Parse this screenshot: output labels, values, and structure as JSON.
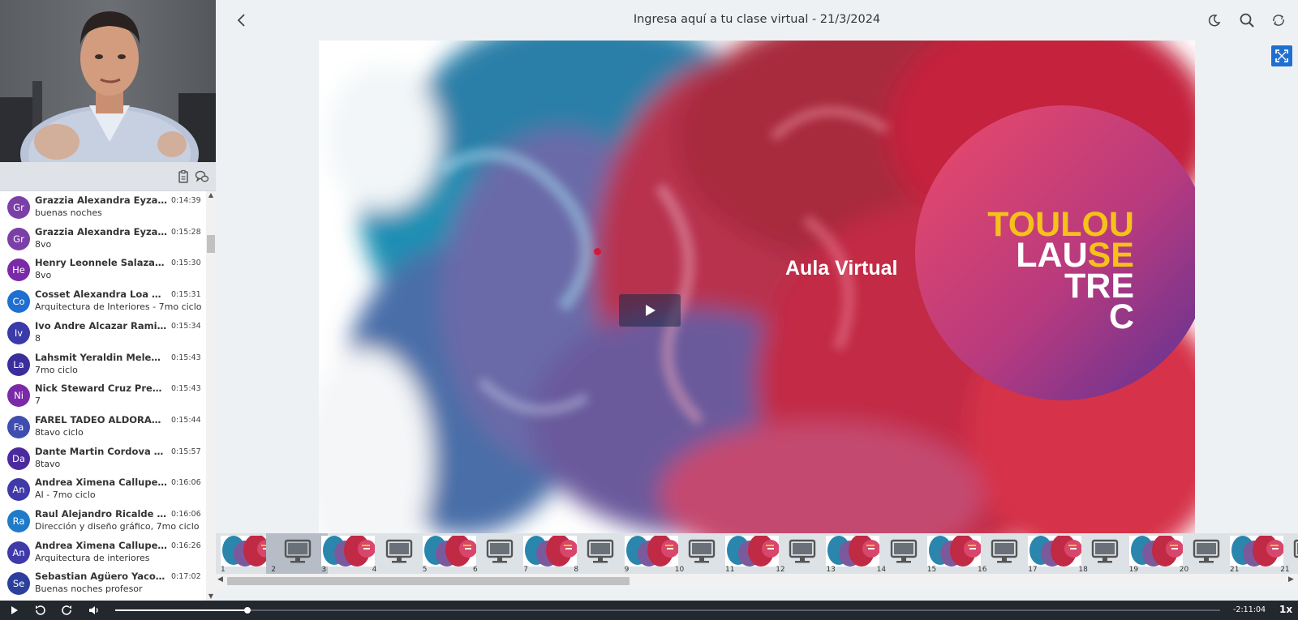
{
  "header": {
    "title": "Ingresa aquí a tu clase virtual - 21/3/2024"
  },
  "slide": {
    "heading": "Aula Virtual",
    "logo_lines": [
      {
        "parts": [
          {
            "text": "TOULOU",
            "color": "#f5c11a"
          }
        ]
      },
      {
        "parts": [
          {
            "text": "LAU",
            "color": "#ffffff"
          },
          {
            "text": "SE",
            "color": "#f5c11a"
          }
        ]
      },
      {
        "parts": [
          {
            "text": "TRE",
            "color": "#ffffff"
          }
        ]
      },
      {
        "parts": [
          {
            "text": "C",
            "color": "#ffffff"
          }
        ]
      }
    ]
  },
  "chat": {
    "messages": [
      {
        "initials": "Gr",
        "name": "Grazzia Alexandra Eyzag...",
        "time": "0:14:39",
        "text": "buenas noches",
        "color": "#7b3fa8"
      },
      {
        "initials": "Gr",
        "name": "Grazzia Alexandra Eyzag...",
        "time": "0:15:28",
        "text": "8vo",
        "color": "#7b3fa8"
      },
      {
        "initials": "He",
        "name": "Henry Leonnele Salazar ...",
        "time": "0:15:30",
        "text": "8vo",
        "color": "#7a2aa8"
      },
      {
        "initials": "Co",
        "name": "Cosset Alexandra Loa Cruz",
        "time": "0:15:31",
        "text": "Arquitectura de Interiores - 7mo ciclo",
        "color": "#1f6fd1"
      },
      {
        "initials": "Iv",
        "name": "Ivo Andre Alcazar Ramirez",
        "time": "0:15:34",
        "text": "8",
        "color": "#3a3aa8"
      },
      {
        "initials": "La",
        "name": "Lahsmit Yeraldin Melend...",
        "time": "0:15:43",
        "text": "7mo ciclo",
        "color": "#3a2d9c"
      },
      {
        "initials": "Ni",
        "name": "Nick Steward Cruz Precia...",
        "time": "0:15:43",
        "text": "7",
        "color": "#7a2aa8"
      },
      {
        "initials": "Fa",
        "name": "FAREL TADEO ALDORADI...",
        "time": "0:15:44",
        "text": "8tavo ciclo",
        "color": "#3f4cb0"
      },
      {
        "initials": "Da",
        "name": "Dante Martin Cordova M...",
        "time": "0:15:57",
        "text": "8tavo",
        "color": "#4a2a9c"
      },
      {
        "initials": "An",
        "name": "Andrea Ximena Callupe Y...",
        "time": "0:16:06",
        "text": "AI - 7mo ciclo",
        "color": "#3f3aa8"
      },
      {
        "initials": "Ra",
        "name": "Raul Alejandro Ricalde C...",
        "time": "0:16:06",
        "text": "Dirección y diseño gráfico, 7mo ciclo",
        "color": "#1f7ac8"
      },
      {
        "initials": "An",
        "name": "Andrea Ximena Callupe Y...",
        "time": "0:16:26",
        "text": "Arquitectura de interiores",
        "color": "#3f3aa8"
      },
      {
        "initials": "Se",
        "name": "Sebastian Agüero Yacolca",
        "time": "0:17:02",
        "text": "Buenas noches profesor",
        "color": "#2d3f9c"
      }
    ]
  },
  "thumbnails": [
    {
      "num": "1",
      "kind": "slide"
    },
    {
      "num": "2",
      "kind": "screen",
      "active": true
    },
    {
      "num": "3",
      "kind": "slide"
    },
    {
      "num": "4",
      "kind": "screen"
    },
    {
      "num": "5",
      "kind": "slide"
    },
    {
      "num": "6",
      "kind": "screen"
    },
    {
      "num": "7",
      "kind": "slide"
    },
    {
      "num": "8",
      "kind": "screen"
    },
    {
      "num": "9",
      "kind": "slide"
    },
    {
      "num": "10",
      "kind": "screen"
    },
    {
      "num": "11",
      "kind": "slide"
    },
    {
      "num": "12",
      "kind": "screen"
    },
    {
      "num": "13",
      "kind": "slide"
    },
    {
      "num": "14",
      "kind": "screen"
    },
    {
      "num": "15",
      "kind": "slide"
    },
    {
      "num": "16",
      "kind": "screen"
    },
    {
      "num": "17",
      "kind": "slide"
    },
    {
      "num": "18",
      "kind": "screen"
    },
    {
      "num": "19",
      "kind": "slide"
    },
    {
      "num": "20",
      "kind": "screen"
    },
    {
      "num": "21",
      "kind": "slide"
    },
    {
      "num": "21",
      "kind": "screen"
    }
  ],
  "player": {
    "progress_fraction": 0.12,
    "time_remaining": "-2:11:04",
    "speed": "1x"
  },
  "colors": {
    "accent": "#1f6fd1",
    "player_bg": "#23272e",
    "logo_yellow": "#f5c11a",
    "logo_pink": "#e8476a",
    "logo_purple": "#6b3a9c"
  },
  "icons": {
    "back": "chevron-left-icon",
    "theme": "moon-icon",
    "search": "search-icon",
    "refresh": "refresh-icon",
    "fullscreen": "fullscreen-icon",
    "clipboard": "clipboard-icon",
    "chat": "chat-bubbles-icon"
  }
}
